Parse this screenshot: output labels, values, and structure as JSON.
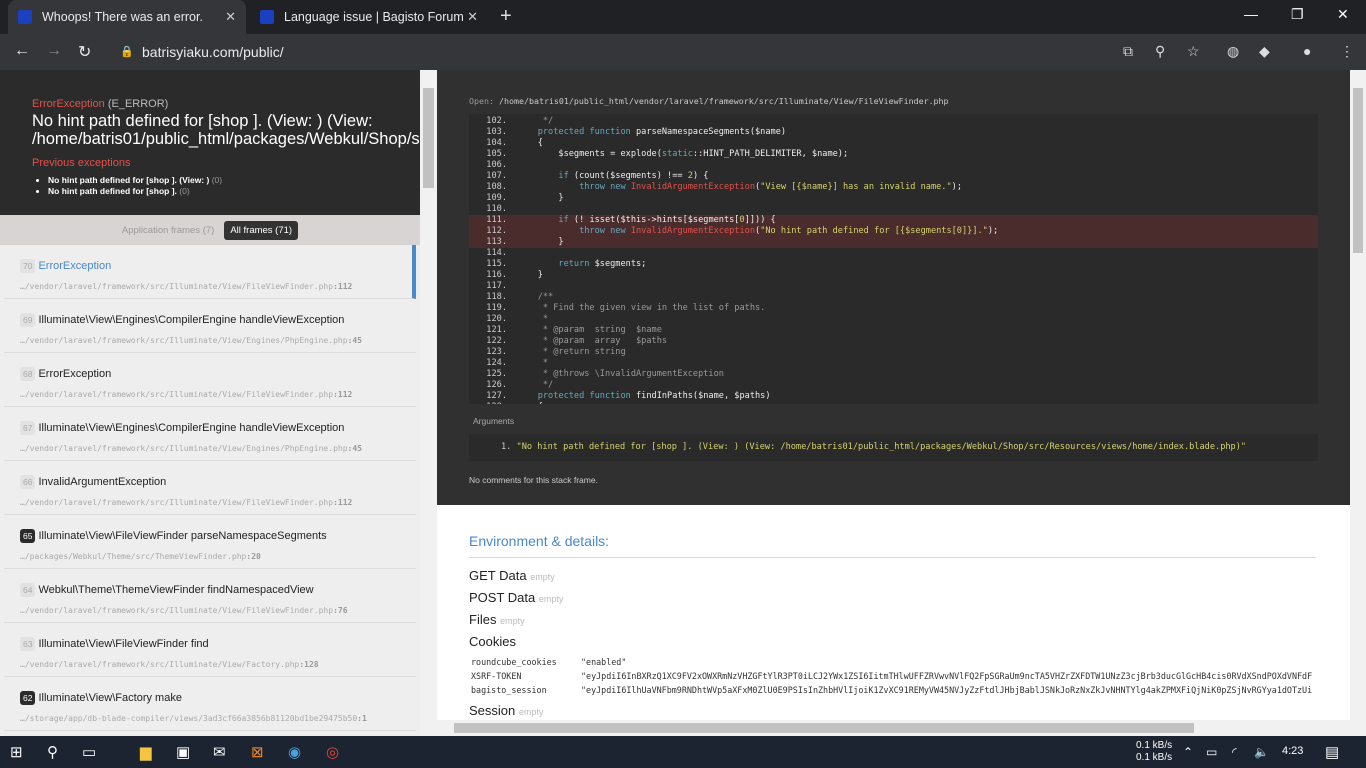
{
  "browser": {
    "tabs": [
      {
        "title": "Whoops! There was an error.",
        "active": true
      },
      {
        "title": "Language issue | Bagisto Forum",
        "active": false
      }
    ],
    "url": "batrisyiaku.com/public/"
  },
  "error": {
    "type": "ErrorException",
    "code": "(E_ERROR)",
    "message": "No hint path defined for [shop ]. (View: ) (View: /home/batris01/public_html/packages/Webkul/Shop/src/Resources/views/home/index.blade.php)",
    "previous_label": "Previous exceptions",
    "previous": [
      {
        "text": "No hint path defined for [shop ]. (View: )",
        "code": "(0)"
      },
      {
        "text": "No hint path defined for [shop ].",
        "code": "(0)"
      }
    ]
  },
  "frame_filter": {
    "app": "Application frames (7)",
    "all": "All frames (71)"
  },
  "frames": [
    {
      "num": "70",
      "cls": "ErrorException",
      "file": "…/vendor/laravel/framework/src/Illuminate/View/FileViewFinder.php",
      "line": ":112",
      "app": false,
      "active": true
    },
    {
      "num": "69",
      "cls": "Illuminate\\View\\Engines\\CompilerEngine handleViewException",
      "file": "…/vendor/laravel/framework/src/Illuminate/View/Engines/PhpEngine.php",
      "line": ":45",
      "app": false
    },
    {
      "num": "68",
      "cls": "ErrorException",
      "file": "…/vendor/laravel/framework/src/Illuminate/View/FileViewFinder.php",
      "line": ":112",
      "app": false
    },
    {
      "num": "67",
      "cls": "Illuminate\\View\\Engines\\CompilerEngine handleViewException",
      "file": "…/vendor/laravel/framework/src/Illuminate/View/Engines/PhpEngine.php",
      "line": ":45",
      "app": false
    },
    {
      "num": "66",
      "cls": "InvalidArgumentException",
      "file": "…/vendor/laravel/framework/src/Illuminate/View/FileViewFinder.php",
      "line": ":112",
      "app": false
    },
    {
      "num": "65",
      "cls": "Illuminate\\View\\FileViewFinder parseNamespaceSegments",
      "file": "…/packages/Webkul/Theme/src/ThemeViewFinder.php",
      "line": ":20",
      "app": true
    },
    {
      "num": "64",
      "cls": "Webkul\\Theme\\ThemeViewFinder findNamespacedView",
      "file": "…/vendor/laravel/framework/src/Illuminate/View/FileViewFinder.php",
      "line": ":76",
      "app": false
    },
    {
      "num": "63",
      "cls": "Illuminate\\View\\FileViewFinder find",
      "file": "…/vendor/laravel/framework/src/Illuminate/View/Factory.php",
      "line": ":128",
      "app": false
    },
    {
      "num": "62",
      "cls": "Illuminate\\View\\Factory make",
      "file": "…/storage/app/db-blade-compiler/views/3ad3cf66a3856b81120bd1be29475b50",
      "line": ":1",
      "app": true
    }
  ],
  "code": {
    "open_label": "Open:",
    "path": "/home/batris01/public_html/vendor/laravel/framework/src/Illuminate/View/FileViewFinder.php",
    "lines": [
      {
        "n": "102.",
        "t": [
          [
            "c",
            "     */"
          ]
        ]
      },
      {
        "n": "103.",
        "t": [
          [
            "k",
            "    protected function "
          ],
          [
            "n",
            "parseNamespaceSegments($name)"
          ]
        ]
      },
      {
        "n": "104.",
        "t": [
          [
            "n",
            "    {"
          ]
        ]
      },
      {
        "n": "105.",
        "t": [
          [
            "n",
            "        $segments = explode("
          ],
          [
            "k",
            "static"
          ],
          [
            "n",
            "::HINT_PATH_DELIMITER, $name);"
          ]
        ]
      },
      {
        "n": "106.",
        "t": []
      },
      {
        "n": "107.",
        "t": [
          [
            "k",
            "        if "
          ],
          [
            "n",
            "(count($segments) !== "
          ],
          [
            "d",
            "2"
          ],
          [
            "n",
            ") {"
          ]
        ]
      },
      {
        "n": "108.",
        "t": [
          [
            "k",
            "            throw new "
          ],
          [
            "e",
            "InvalidArgumentException"
          ],
          [
            "n",
            "("
          ],
          [
            "s",
            "\"View [{$name}] has an invalid name.\""
          ],
          [
            "n",
            ");"
          ]
        ]
      },
      {
        "n": "109.",
        "t": [
          [
            "n",
            "        }"
          ]
        ]
      },
      {
        "n": "110.",
        "t": []
      },
      {
        "n": "111.",
        "t": [
          [
            "k",
            "        if "
          ],
          [
            "n",
            "(! isset($this->hints[$segments["
          ],
          [
            "d",
            "0"
          ],
          [
            "n",
            "]])) {"
          ]
        ],
        "hl": true
      },
      {
        "n": "112.",
        "t": [
          [
            "k",
            "            throw new "
          ],
          [
            "e",
            "InvalidArgumentException"
          ],
          [
            "n",
            "("
          ],
          [
            "s",
            "\"No hint path defined for [{$segments[0]}].\""
          ],
          [
            "n",
            ");"
          ]
        ],
        "hl": true
      },
      {
        "n": "113.",
        "t": [
          [
            "n",
            "        }"
          ]
        ],
        "hl": true
      },
      {
        "n": "114.",
        "t": []
      },
      {
        "n": "115.",
        "t": [
          [
            "k",
            "        return "
          ],
          [
            "n",
            "$segments;"
          ]
        ]
      },
      {
        "n": "116.",
        "t": [
          [
            "n",
            "    }"
          ]
        ]
      },
      {
        "n": "117.",
        "t": []
      },
      {
        "n": "118.",
        "t": [
          [
            "c",
            "    /**"
          ]
        ]
      },
      {
        "n": "119.",
        "t": [
          [
            "c",
            "     * Find the given view in the list of paths."
          ]
        ]
      },
      {
        "n": "120.",
        "t": [
          [
            "c",
            "     *"
          ]
        ]
      },
      {
        "n": "121.",
        "t": [
          [
            "c",
            "     * @param  string  $name"
          ]
        ]
      },
      {
        "n": "122.",
        "t": [
          [
            "c",
            "     * @param  array   $paths"
          ]
        ]
      },
      {
        "n": "123.",
        "t": [
          [
            "c",
            "     * @return string"
          ]
        ]
      },
      {
        "n": "124.",
        "t": [
          [
            "c",
            "     *"
          ]
        ]
      },
      {
        "n": "125.",
        "t": [
          [
            "c",
            "     * @throws \\InvalidArgumentException"
          ]
        ]
      },
      {
        "n": "126.",
        "t": [
          [
            "c",
            "     */"
          ]
        ]
      },
      {
        "n": "127.",
        "t": [
          [
            "k",
            "    protected function "
          ],
          [
            "n",
            "findInPaths($name, $paths)"
          ]
        ]
      },
      {
        "n": "128.",
        "t": [
          [
            "n",
            "    {"
          ]
        ]
      }
    ]
  },
  "arguments": {
    "label": "Arguments",
    "items": [
      {
        "n": "1.",
        "value": "\"No hint path defined for [shop ]. (View: ) (View: /home/batris01/public_html/packages/Webkul/Shop/src/Resources/views/home/index.blade.php)\""
      }
    ],
    "no_comments": "No comments for this stack frame."
  },
  "env": {
    "title": "Environment & details:",
    "empty": "empty",
    "sections": {
      "get": "GET Data",
      "post": "POST Data",
      "files": "Files",
      "cookies": "Cookies",
      "session": "Session"
    },
    "cookies": [
      {
        "k": "roundcube_cookies",
        "v": "\"enabled\""
      },
      {
        "k": "XSRF-TOKEN",
        "v": "\"eyJpdiI6InBXRzQ1XC9FV2xOWXRmNzVHZGFtYlR3PT0iLCJ2YWx1ZSI6IitmTHlwUFFZRVwvNVlFQ2FpSGRaUm9ncTA5VHZrZXFDTW1UNzZ3cjBrb3ducGlGcHB4cis0RVdXSndPOXdVNFdF"
      },
      {
        "k": "bagisto_session",
        "v": "\"eyJpdiI6IlhUaVNFbm9RNDhtWVp5aXFxM0ZlU0E9PSIsInZhbHVlIjoiK1ZvXC91REMyVW45NVJyZzFtdlJHbjBablJSNkJoRzNxZkJvNHNTYlg4akZPMXFiQjNiK0pZSjNvRGYya1dOTzUi"
      }
    ]
  },
  "taskbar": {
    "net_up": "0.1 kB/s",
    "net_down": "0.1 kB/s",
    "time": "4:23"
  }
}
